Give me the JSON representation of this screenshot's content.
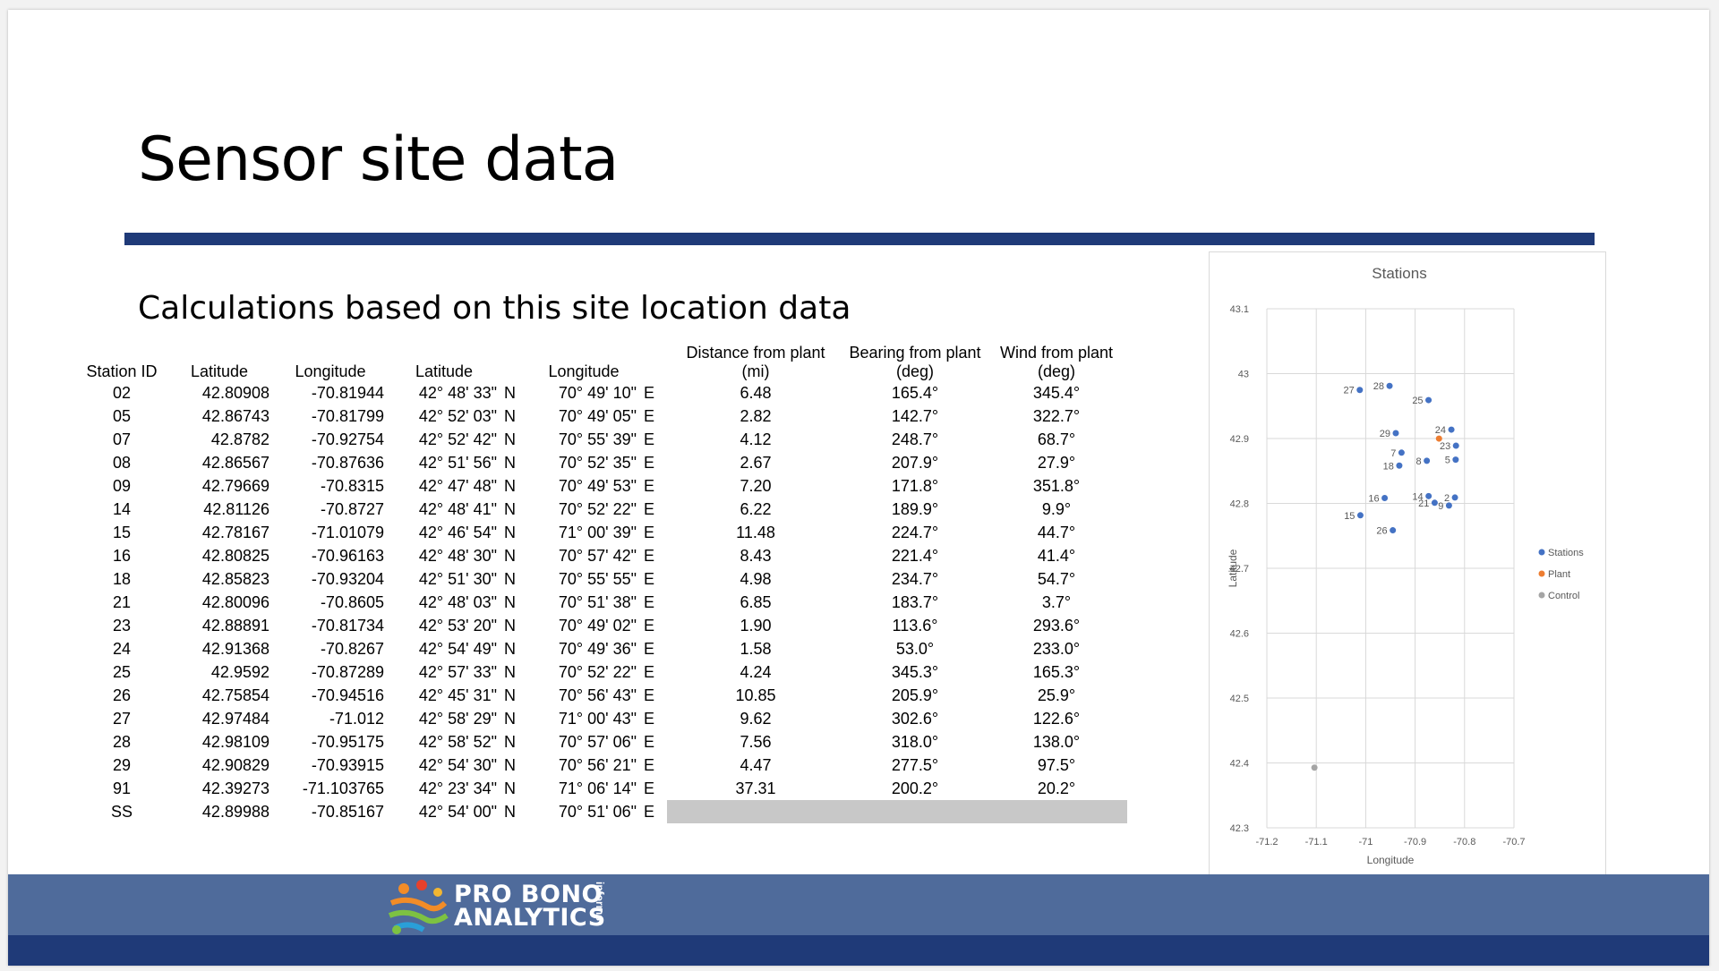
{
  "slide": {
    "title": "Sensor site data",
    "subtitle": "Calculations based on this site location data"
  },
  "table": {
    "headers": {
      "station_id": "Station ID",
      "latitude": "Latitude",
      "longitude": "Longitude",
      "latitude_dms": "Latitude",
      "longitude_dms": "Longitude",
      "distance": "Distance from plant (mi)",
      "bearing_line1": "Bearing from plant",
      "bearing_line2": "(deg)",
      "wind_line1": "Wind from plant",
      "wind_line2": "(deg)"
    },
    "rows": [
      {
        "id": "02",
        "lat": "42.80908",
        "lon": "-70.81944",
        "lat_dms": "42° 48' 33\"",
        "ns": "N",
        "lon_dms": "70° 49' 10\"",
        "ew": "E",
        "dist": "6.48",
        "bearing": "165.4°",
        "wind": "345.4°"
      },
      {
        "id": "05",
        "lat": "42.86743",
        "lon": "-70.81799",
        "lat_dms": "42° 52' 03\"",
        "ns": "N",
        "lon_dms": "70° 49' 05\"",
        "ew": "E",
        "dist": "2.82",
        "bearing": "142.7°",
        "wind": "322.7°"
      },
      {
        "id": "07",
        "lat": "42.8782",
        "lon": "-70.92754",
        "lat_dms": "42° 52' 42\"",
        "ns": "N",
        "lon_dms": "70° 55' 39\"",
        "ew": "E",
        "dist": "4.12",
        "bearing": "248.7°",
        "wind": "68.7°"
      },
      {
        "id": "08",
        "lat": "42.86567",
        "lon": "-70.87636",
        "lat_dms": "42° 51' 56\"",
        "ns": "N",
        "lon_dms": "70° 52' 35\"",
        "ew": "E",
        "dist": "2.67",
        "bearing": "207.9°",
        "wind": "27.9°"
      },
      {
        "id": "09",
        "lat": "42.79669",
        "lon": "-70.8315",
        "lat_dms": "42° 47' 48\"",
        "ns": "N",
        "lon_dms": "70° 49' 53\"",
        "ew": "E",
        "dist": "7.20",
        "bearing": "171.8°",
        "wind": "351.8°"
      },
      {
        "id": "14",
        "lat": "42.81126",
        "lon": "-70.8727",
        "lat_dms": "42° 48' 41\"",
        "ns": "N",
        "lon_dms": "70° 52' 22\"",
        "ew": "E",
        "dist": "6.22",
        "bearing": "189.9°",
        "wind": "9.9°"
      },
      {
        "id": "15",
        "lat": "42.78167",
        "lon": "-71.01079",
        "lat_dms": "42° 46' 54\"",
        "ns": "N",
        "lon_dms": "71° 00' 39\"",
        "ew": "E",
        "dist": "11.48",
        "bearing": "224.7°",
        "wind": "44.7°"
      },
      {
        "id": "16",
        "lat": "42.80825",
        "lon": "-70.96163",
        "lat_dms": "42° 48' 30\"",
        "ns": "N",
        "lon_dms": "70° 57' 42\"",
        "ew": "E",
        "dist": "8.43",
        "bearing": "221.4°",
        "wind": "41.4°"
      },
      {
        "id": "18",
        "lat": "42.85823",
        "lon": "-70.93204",
        "lat_dms": "42° 51' 30\"",
        "ns": "N",
        "lon_dms": "70° 55' 55\"",
        "ew": "E",
        "dist": "4.98",
        "bearing": "234.7°",
        "wind": "54.7°"
      },
      {
        "id": "21",
        "lat": "42.80096",
        "lon": "-70.8605",
        "lat_dms": "42° 48' 03\"",
        "ns": "N",
        "lon_dms": "70° 51' 38\"",
        "ew": "E",
        "dist": "6.85",
        "bearing": "183.7°",
        "wind": "3.7°"
      },
      {
        "id": "23",
        "lat": "42.88891",
        "lon": "-70.81734",
        "lat_dms": "42° 53' 20\"",
        "ns": "N",
        "lon_dms": "70° 49' 02\"",
        "ew": "E",
        "dist": "1.90",
        "bearing": "113.6°",
        "wind": "293.6°"
      },
      {
        "id": "24",
        "lat": "42.91368",
        "lon": "-70.8267",
        "lat_dms": "42° 54' 49\"",
        "ns": "N",
        "lon_dms": "70° 49' 36\"",
        "ew": "E",
        "dist": "1.58",
        "bearing": "53.0°",
        "wind": "233.0°"
      },
      {
        "id": "25",
        "lat": "42.9592",
        "lon": "-70.87289",
        "lat_dms": "42° 57' 33\"",
        "ns": "N",
        "lon_dms": "70° 52' 22\"",
        "ew": "E",
        "dist": "4.24",
        "bearing": "345.3°",
        "wind": "165.3°"
      },
      {
        "id": "26",
        "lat": "42.75854",
        "lon": "-70.94516",
        "lat_dms": "42° 45' 31\"",
        "ns": "N",
        "lon_dms": "70° 56' 43\"",
        "ew": "E",
        "dist": "10.85",
        "bearing": "205.9°",
        "wind": "25.9°"
      },
      {
        "id": "27",
        "lat": "42.97484",
        "lon": "-71.012",
        "lat_dms": "42° 58' 29\"",
        "ns": "N",
        "lon_dms": "71° 00' 43\"",
        "ew": "E",
        "dist": "9.62",
        "bearing": "302.6°",
        "wind": "122.6°"
      },
      {
        "id": "28",
        "lat": "42.98109",
        "lon": "-70.95175",
        "lat_dms": "42° 58' 52\"",
        "ns": "N",
        "lon_dms": "70° 57' 06\"",
        "ew": "E",
        "dist": "7.56",
        "bearing": "318.0°",
        "wind": "138.0°"
      },
      {
        "id": "29",
        "lat": "42.90829",
        "lon": "-70.93915",
        "lat_dms": "42° 54' 30\"",
        "ns": "N",
        "lon_dms": "70° 56' 21\"",
        "ew": "E",
        "dist": "4.47",
        "bearing": "277.5°",
        "wind": "97.5°"
      },
      {
        "id": "91",
        "lat": "42.39273",
        "lon": "-71.103765",
        "lat_dms": "42° 23' 34\"",
        "ns": "N",
        "lon_dms": "71° 06' 14\"",
        "ew": "E",
        "dist": "37.31",
        "bearing": "200.2°",
        "wind": "20.2°"
      },
      {
        "id": "SS",
        "lat": "42.89988",
        "lon": "-70.85167",
        "lat_dms": "42° 54' 00\"",
        "ns": "N",
        "lon_dms": "70° 51' 06\"",
        "ew": "E",
        "dist": "",
        "bearing": "",
        "wind": "",
        "blank": true
      }
    ]
  },
  "chart_data": {
    "type": "scatter",
    "title": "Stations",
    "xlabel": "Longitude",
    "ylabel": "Latitude",
    "xlim": [
      -71.2,
      -70.7
    ],
    "ylim": [
      42.3,
      43.1
    ],
    "xticks": [
      "-71.2",
      "-71.1",
      "-71",
      "-70.9",
      "-70.8",
      "-70.7"
    ],
    "yticks": [
      "42.3",
      "42.4",
      "42.5",
      "42.6",
      "42.7",
      "42.8",
      "42.9",
      "43",
      "43.1"
    ],
    "grid": true,
    "legend_position": "right",
    "series": [
      {
        "name": "Stations",
        "color": "#4472c4",
        "points": [
          {
            "label": "2",
            "x": -70.81944,
            "y": 42.80908
          },
          {
            "label": "5",
            "x": -70.81799,
            "y": 42.86743
          },
          {
            "label": "7",
            "x": -70.92754,
            "y": 42.8782
          },
          {
            "label": "8",
            "x": -70.87636,
            "y": 42.86567
          },
          {
            "label": "9",
            "x": -70.8315,
            "y": 42.79669
          },
          {
            "label": "14",
            "x": -70.8727,
            "y": 42.81126
          },
          {
            "label": "15",
            "x": -71.01079,
            "y": 42.78167
          },
          {
            "label": "16",
            "x": -70.96163,
            "y": 42.80825
          },
          {
            "label": "18",
            "x": -70.93204,
            "y": 42.85823
          },
          {
            "label": "21",
            "x": -70.8605,
            "y": 42.80096
          },
          {
            "label": "23",
            "x": -70.81734,
            "y": 42.88891
          },
          {
            "label": "24",
            "x": -70.8267,
            "y": 42.91368
          },
          {
            "label": "25",
            "x": -70.87289,
            "y": 42.9592
          },
          {
            "label": "26",
            "x": -70.94516,
            "y": 42.75854
          },
          {
            "label": "27",
            "x": -71.012,
            "y": 42.97484
          },
          {
            "label": "28",
            "x": -70.95175,
            "y": 42.98109
          },
          {
            "label": "29",
            "x": -70.93915,
            "y": 42.90829
          }
        ]
      },
      {
        "name": "Plant",
        "color": "#ed7d31",
        "points": [
          {
            "label": "",
            "x": -70.85167,
            "y": 42.89988
          }
        ]
      },
      {
        "name": "Control",
        "color": "#a5a5a5",
        "points": [
          {
            "label": "",
            "x": -71.103765,
            "y": 42.39273
          }
        ]
      }
    ]
  },
  "footer": {
    "logo_line1": "PRO BONO",
    "logo_line2": "ANALYTICS",
    "logo_side": "informs"
  }
}
